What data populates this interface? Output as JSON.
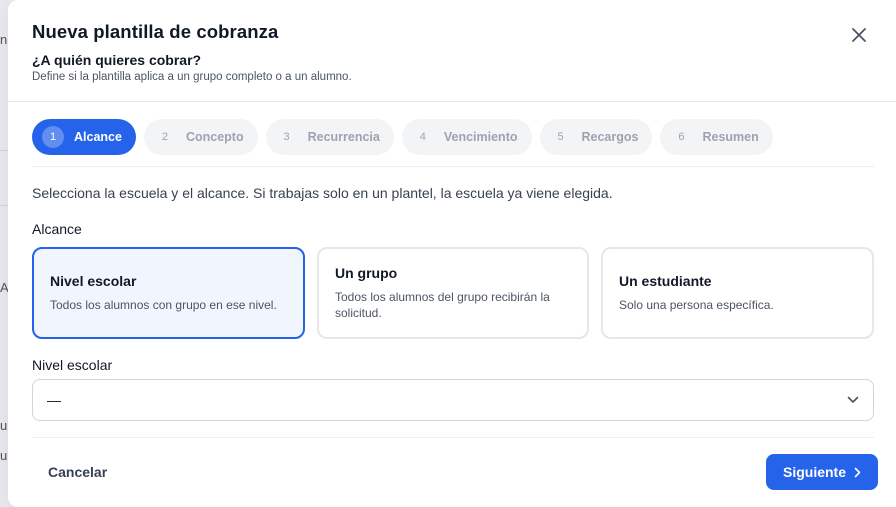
{
  "background": {
    "edge_letters": [
      "n",
      "A",
      "u",
      "u"
    ]
  },
  "modal": {
    "title": "Nueva plantilla de cobranza",
    "subtitle": "¿A quién quieres cobrar?",
    "description": "Define si la plantilla aplica a un grupo completo o a un alumno.",
    "close_icon": "close-icon"
  },
  "stepper": {
    "active_index": 0,
    "steps": [
      {
        "number": "1",
        "label": "Alcance"
      },
      {
        "number": "2",
        "label": "Concepto"
      },
      {
        "number": "3",
        "label": "Recurrencia"
      },
      {
        "number": "4",
        "label": "Vencimiento"
      },
      {
        "number": "5",
        "label": "Recargos"
      },
      {
        "number": "6",
        "label": "Resumen"
      }
    ]
  },
  "content": {
    "instruction": "Selecciona la escuela y el alcance. Si trabajas solo en un plantel, la escuela ya viene elegida.",
    "scope_label": "Alcance",
    "options": [
      {
        "title": "Nivel escolar",
        "description": "Todos los alumnos con grupo en ese nivel.",
        "selected": true
      },
      {
        "title": "Un grupo",
        "description": "Todos los alumnos del grupo recibirán la solicitud.",
        "selected": false
      },
      {
        "title": "Un estudiante",
        "description": "Solo una persona específica.",
        "selected": false
      }
    ],
    "level_label": "Nivel escolar",
    "level_select": {
      "value": "—",
      "icon": "chevron-down-icon"
    }
  },
  "footer": {
    "cancel_label": "Cancelar",
    "next_label": "Siguiente",
    "next_icon": "chevron-right-icon"
  },
  "colors": {
    "primary": "#2563eb",
    "selected_bg": "#f1f5fd",
    "step_inactive_bg": "#f3f4f6"
  }
}
